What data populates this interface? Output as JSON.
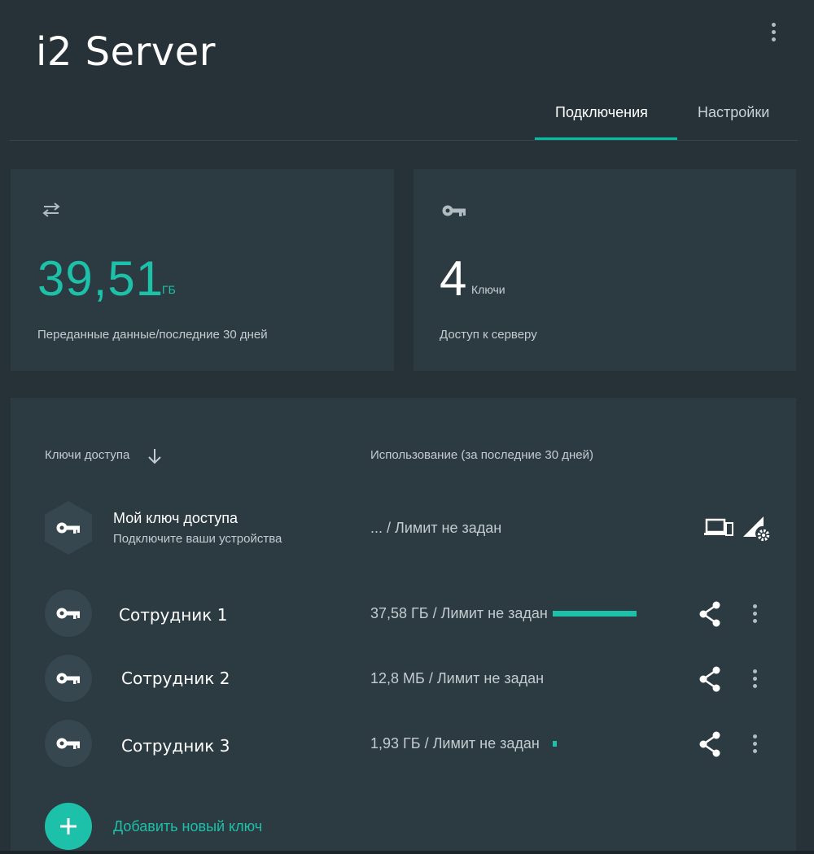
{
  "header": {
    "title": "i2 Server",
    "tabs": [
      {
        "label": "Подключения",
        "active": true
      },
      {
        "label": "Настройки",
        "active": false
      }
    ]
  },
  "stats": {
    "transfer": {
      "icon": "swap-arrows-icon",
      "value": "39,51",
      "unit": "ГБ",
      "caption": "Переданные данные/последние 30 дней"
    },
    "keys": {
      "icon": "key-icon",
      "value": "4",
      "unit": "Ключи",
      "caption": "Доступ к серверу"
    }
  },
  "table": {
    "col_keys": "Ключи доступа",
    "col_usage": "Использование (за последние 30 дней)",
    "my_key": {
      "name": "Мой ключ доступа",
      "subtitle": "Подключите ваши устройства",
      "usage": "... / Лимит не задан"
    },
    "rows": [
      {
        "name": "Сотрудник 1",
        "usage": "37,58 ГБ / Лимит не задан",
        "usage_fraction": 0.95
      },
      {
        "name": "Сотрудник 2",
        "usage": "12,8 МБ / Лимит не задан",
        "usage_fraction": 0.0
      },
      {
        "name": "Сотрудник 3",
        "usage": "1,93 ГБ / Лимит не задан",
        "usage_fraction": 0.05
      }
    ]
  },
  "add_key_label": "Добавить новый ключ",
  "colors": {
    "accent": "#1dc0a8",
    "background": "#263238",
    "card": "#2c3b41"
  }
}
